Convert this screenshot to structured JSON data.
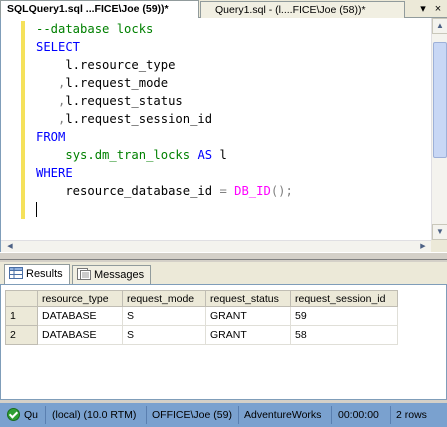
{
  "doc_tabs": [
    {
      "label": "SQLQuery1.sql ...FICE\\Joe (59))*",
      "active": true
    },
    {
      "label": "Query1.sql - (l....FICE\\Joe (58))*",
      "active": false
    }
  ],
  "tab_close_glyph": "×",
  "tab_dropdown_glyph": "▾",
  "editor": {
    "lines": [
      [
        {
          "t": "--database locks",
          "c": "cm"
        }
      ],
      [
        {
          "t": "SELECT",
          "c": "kw"
        }
      ],
      [
        {
          "t": "    l.resource_type",
          "c": "id"
        }
      ],
      [
        {
          "t": "   ",
          "c": "id"
        },
        {
          "t": ",",
          "c": "op"
        },
        {
          "t": "l.request_mode",
          "c": "id"
        }
      ],
      [
        {
          "t": "   ",
          "c": "id"
        },
        {
          "t": ",",
          "c": "op"
        },
        {
          "t": "l.request_status",
          "c": "id"
        }
      ],
      [
        {
          "t": "   ",
          "c": "id"
        },
        {
          "t": ",",
          "c": "op"
        },
        {
          "t": "l.request_session_id",
          "c": "id"
        }
      ],
      [
        {
          "t": "FROM",
          "c": "kw"
        }
      ],
      [
        {
          "t": "    ",
          "c": "id"
        },
        {
          "t": "sys.dm_tran_locks",
          "c": "obj"
        },
        {
          "t": " AS ",
          "c": "kw"
        },
        {
          "t": "l",
          "c": "id"
        }
      ],
      [
        {
          "t": "WHERE",
          "c": "kw"
        }
      ],
      [
        {
          "t": "    resource_database_id ",
          "c": "id"
        },
        {
          "t": "=",
          "c": "op"
        },
        {
          "t": " ",
          "c": "id"
        },
        {
          "t": "DB_ID",
          "c": "fn"
        },
        {
          "t": "();",
          "c": "op"
        }
      ],
      [
        {
          "t": "",
          "c": "caret"
        }
      ]
    ]
  },
  "result_tabs": [
    {
      "label": "Results",
      "active": true,
      "icon": "grid-icon"
    },
    {
      "label": "Messages",
      "active": false,
      "icon": "messages-icon"
    }
  ],
  "grid": {
    "columns": [
      "resource_type",
      "request_mode",
      "request_status",
      "request_session_id"
    ],
    "rows": [
      {
        "n": "1",
        "cells": [
          "DATABASE",
          "S",
          "GRANT",
          "59"
        ]
      },
      {
        "n": "2",
        "cells": [
          "DATABASE",
          "S",
          "GRANT",
          "58"
        ]
      }
    ]
  },
  "status": {
    "state": "Qu",
    "server": "(local) (10.0 RTM)",
    "user": "OFFICE\\Joe (59)",
    "database": "AdventureWorks",
    "elapsed": "00:00:00",
    "rows": "2 rows"
  },
  "colors": {
    "keyword": "#0000ff",
    "comment": "#008000",
    "function": "#ff00ff",
    "statusbar": "#7aa1cf"
  }
}
